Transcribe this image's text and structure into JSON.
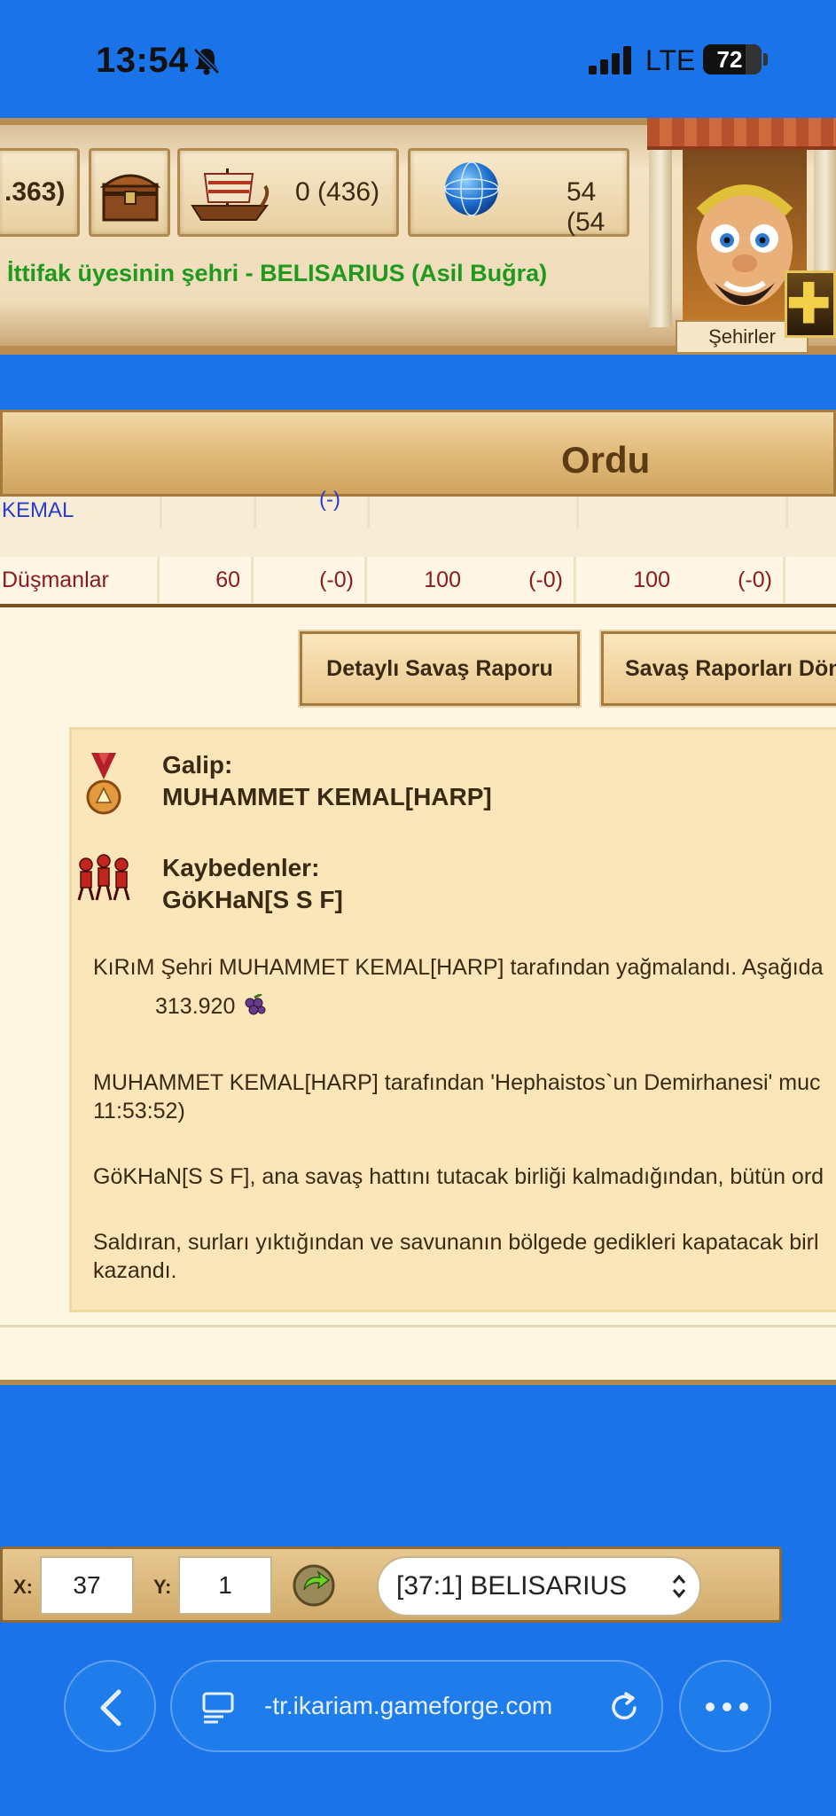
{
  "status_bar": {
    "time": "13:54",
    "network": "LTE",
    "battery": "72",
    "battery_level": 0.72
  },
  "resources": {
    "partial_amount": ".363)",
    "ships": "0 (436)",
    "citizens": "54 (54"
  },
  "city_status": "İttifak üyesinin şehri - BELISARIUS (Asil Buğra)",
  "advisor": {
    "label": "Şehirler"
  },
  "window": {
    "title": "Ordu",
    "ghost_row": {
      "name": "KEMAL",
      "loss": "(-)"
    },
    "row": {
      "name": "Düşmanlar",
      "cells": [
        "60",
        "(-0)",
        "100",
        "(-0)",
        "100",
        "(-0)"
      ]
    },
    "buttons": {
      "detailed_report": "Detaylı Savaş Raporu",
      "back_to_reports": "Savaş Raporları Dön"
    },
    "report": {
      "winner_label": "Galip:",
      "winner_name": "MUHAMMET KEMAL[HARP]",
      "losers_label": "Kaybedenler:",
      "loser_name": "GöKHaN[S S F]",
      "plunder_text": "KıRıM Şehri MUHAMMET KEMAL[HARP] tarafından yağmalandı. Aşağıda",
      "plunder_amount": "313.920",
      "wonder_text_1": "MUHAMMET KEMAL[HARP] tarafından 'Hephaistos`un Demirhanesi' muc",
      "wonder_text_2": "11:53:52)",
      "line_text": "GöKHaN[S S F], ana savaş hattını tutacak birliği kalmadığından, bütün ord",
      "wall_text_1": "Saldıran, surları yıktığından ve savunanın bölgede gedikleri kapatacak birl",
      "wall_text_2": "kazandı."
    }
  },
  "coords": {
    "x_label": "X:",
    "x_value": "37",
    "y_label": "Y:",
    "y_value": "1",
    "selected_city": "[37:1] BELISARIUS"
  },
  "browser": {
    "url": "-tr.ikariam.gameforge.com"
  },
  "icons": {
    "bell": "bell-slash-icon",
    "chest": "chest-icon",
    "ship": "ship-icon",
    "globe": "globe-icon",
    "medal": "medal-icon",
    "soldiers": "soldiers-icon",
    "grape": "grape-icon",
    "go": "go-icon",
    "back": "chevron-left-icon",
    "site": "site-info-icon",
    "reload": "reload-icon",
    "more": "more-icon",
    "plus": "plus-icon"
  },
  "colors": {
    "browser_blue": "#1a73e8",
    "winner_green": "#1f9a1f",
    "enemy_red": "#8b1a1a",
    "parchment": "#fbe6b9"
  }
}
